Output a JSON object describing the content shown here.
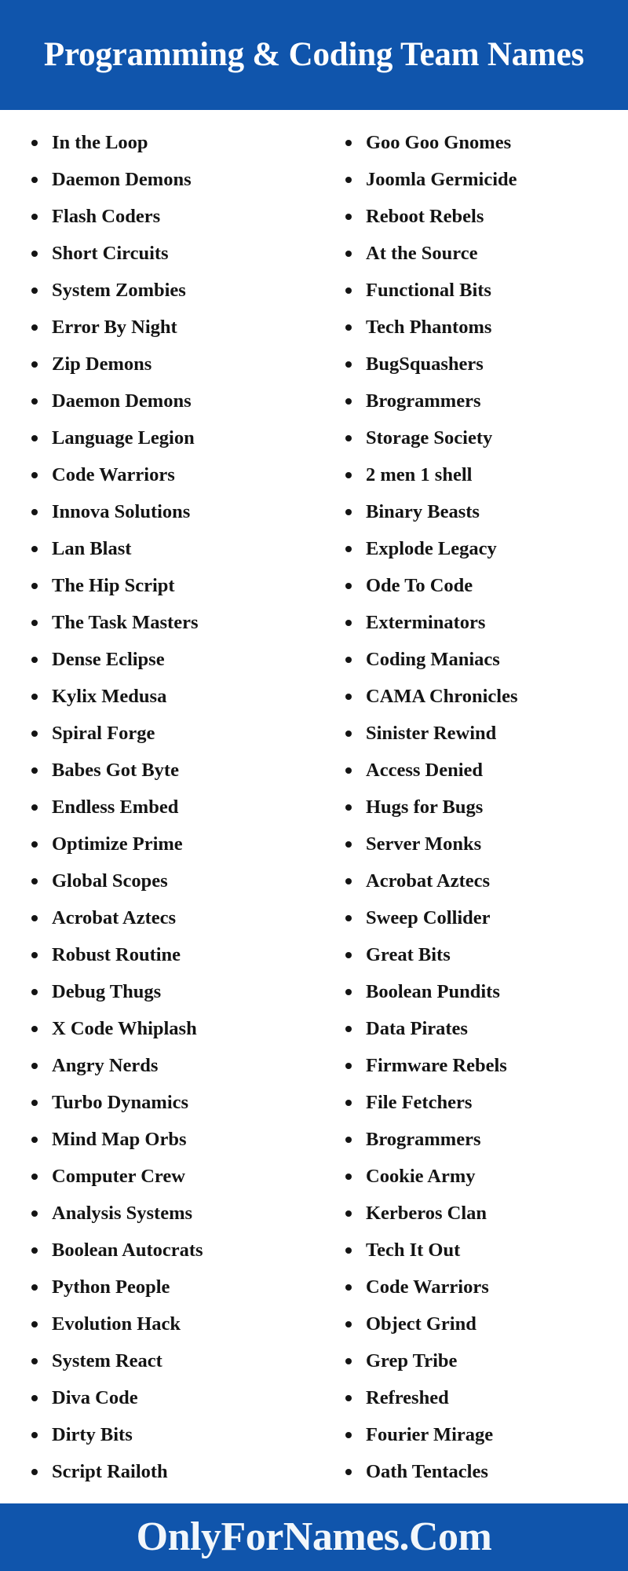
{
  "header": {
    "title": "Programming & Coding Team Names",
    "background_color": "#1055AC",
    "text_color": "#FFFFFF"
  },
  "footer": {
    "site_name": "OnlyForNames.Com",
    "background_color": "#1055AC",
    "text_color": "#F2F7FB"
  },
  "page": {
    "background_color": "#FFFFFF",
    "text_color": "#141414",
    "bullet_glyph": "•"
  },
  "lists": {
    "left_column": [
      "In the Loop",
      "Daemon Demons",
      "Flash Coders",
      "Short Circuits",
      "System Zombies",
      "Error By Night",
      "Zip Demons",
      "Daemon Demons",
      "Language Legion",
      "Code Warriors",
      "Innova Solutions",
      "Lan Blast",
      "The Hip Script",
      "The Task Masters",
      "Dense Eclipse",
      "Kylix Medusa",
      "Spiral Forge",
      "Babes Got Byte",
      "Endless Embed",
      "Optimize Prime",
      "Global Scopes",
      "Acrobat Aztecs",
      "Robust Routine",
      "Debug Thugs",
      "X Code Whiplash",
      "Angry Nerds",
      "Turbo Dynamics",
      "Mind Map Orbs",
      "Computer Crew",
      "Analysis Systems",
      "Boolean Autocrats",
      "Python People",
      "Evolution Hack",
      "System React",
      "Diva Code",
      "Dirty Bits",
      "Script Railoth"
    ],
    "right_column": [
      "Goo Goo Gnomes",
      "Joomla Germicide",
      "Reboot Rebels",
      "At the Source",
      "Functional Bits",
      "Tech Phantoms",
      "BugSquashers",
      "Brogrammers",
      "Storage Society",
      "2 men 1 shell",
      "Binary Beasts",
      "Explode Legacy",
      "Ode To Code",
      "Exterminators",
      "Coding Maniacs",
      "CAMA Chronicles",
      "Sinister Rewind",
      "Access Denied",
      "Hugs for Bugs",
      "Server Monks",
      "Acrobat Aztecs",
      "Sweep Collider",
      "Great Bits",
      "Boolean Pundits",
      "Data Pirates",
      "Firmware Rebels",
      "File Fetchers",
      "Brogrammers",
      "Cookie Army",
      "Kerberos Clan",
      "Tech It Out",
      "Code Warriors",
      "Object Grind",
      "Grep Tribe",
      "Refreshed",
      "Fourier Mirage",
      "Oath Tentacles"
    ]
  }
}
